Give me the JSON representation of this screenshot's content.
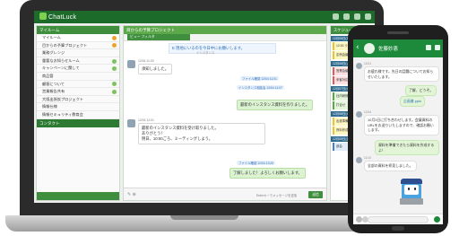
{
  "desktop": {
    "app_name": "ChatLuck",
    "sidebar_header": "マイルーム",
    "sidebar_items": [
      {
        "label": "マイルーム",
        "badge": "orange"
      },
      {
        "label": "目からの予算プロジェクト",
        "badge": "orange"
      },
      {
        "label": "業務グレンジ",
        "badge": ""
      },
      {
        "label": "重要なお知らせルーム",
        "badge": "green"
      },
      {
        "label": "キャンペーンに関して",
        "badge": "green"
      },
      {
        "label": "商品管",
        "badge": ""
      },
      {
        "label": "顧客について",
        "badge": "green"
      },
      {
        "label": "営業報告共有",
        "badge": "green"
      },
      {
        "label": "大阪出張仮プロジェクト",
        "badge": ""
      },
      {
        "label": "情報仕様",
        "badge": ""
      },
      {
        "label": "情報セキュリティ教育会",
        "badge": ""
      }
    ],
    "sidebar_section2": "コンタクト",
    "chat_title": "目からの予算プロジェクト",
    "chat_tab": "ビュー フィルタ",
    "pinned_text": "E 現地にいるのを今日中にお願いします。",
    "pinned_sub": "インスタンス",
    "messages": [
      {
        "text": "承知しました。",
        "side": "left",
        "time": "12/04 11:03"
      },
      {
        "text": "ファイル確認 12/04 11:01",
        "side": "right"
      },
      {
        "text": "インスタンス相談会 12/04 11:07",
        "side": "right"
      },
      {
        "text": "最新のインスタンス資料を作りました。",
        "side": "right",
        "time": "12/04 11:07"
      },
      {
        "text": "最新のインスタンス資料を受け取りました。",
        "side": "left",
        "time": "12/04 12:01"
      },
      {
        "text": "ありがとう！",
        "side": "left"
      },
      {
        "text": "明日、10:00ごろ、ミーティングしよう。",
        "side": "left"
      },
      {
        "text": "ファイル確認 12/04 13:20",
        "side": "right"
      },
      {
        "text": "了解しました！よろしくお願いします。",
        "side": "right",
        "time": "12/04 13:30"
      }
    ],
    "send_label": "送信",
    "input_hint": "Enterキーでメッセージを送信",
    "schedule_title": "スケジュール",
    "schedule": [
      {
        "day": "12月05日(月)",
        "events": [
          {
            "title": "12:00 ランチ会",
            "color": "yellow"
          },
          {
            "title": "定例会議",
            "color": "yellow"
          }
        ]
      },
      {
        "day": "12月06日(火)",
        "events": [
          {
            "title": "営業会議",
            "color": "red"
          },
          {
            "title": "来客対応",
            "color": "red"
          }
        ]
      },
      {
        "day": "12月07日(水)",
        "events": [
          {
            "title": "社内研修",
            "color": "green"
          },
          {
            "title": "打合せ",
            "color": "green"
          }
        ]
      },
      {
        "day": "12月08日(木)",
        "events": [
          {
            "title": "出張準備",
            "color": "yellow"
          },
          {
            "title": "資料作成",
            "color": "yellow"
          }
        ]
      },
      {
        "day": "12月09日(金)",
        "events": [
          {
            "title": "部会",
            "color": "blue"
          }
        ]
      }
    ]
  },
  "phone": {
    "contact_name": "佐藤妙恵",
    "messages": [
      {
        "text": "お疲れ様です。先日の話題についてお知らせいたします。",
        "side": "left",
        "time": "12:01"
      },
      {
        "text": "了解、どうぞ。",
        "side": "right"
      },
      {
        "text": "企画書.pptx",
        "side": "right",
        "link": true
      },
      {
        "text": "10月3日に打ち合わせします。会議資料のURLをお送りいたしますので、確認お願いします。",
        "side": "left",
        "time": "12:04"
      },
      {
        "text": "資料を準備できたら資料を作成するよ！",
        "side": "right"
      },
      {
        "text": "全部の資料を拝見しました。",
        "side": "left",
        "time": "12:10"
      }
    ]
  }
}
